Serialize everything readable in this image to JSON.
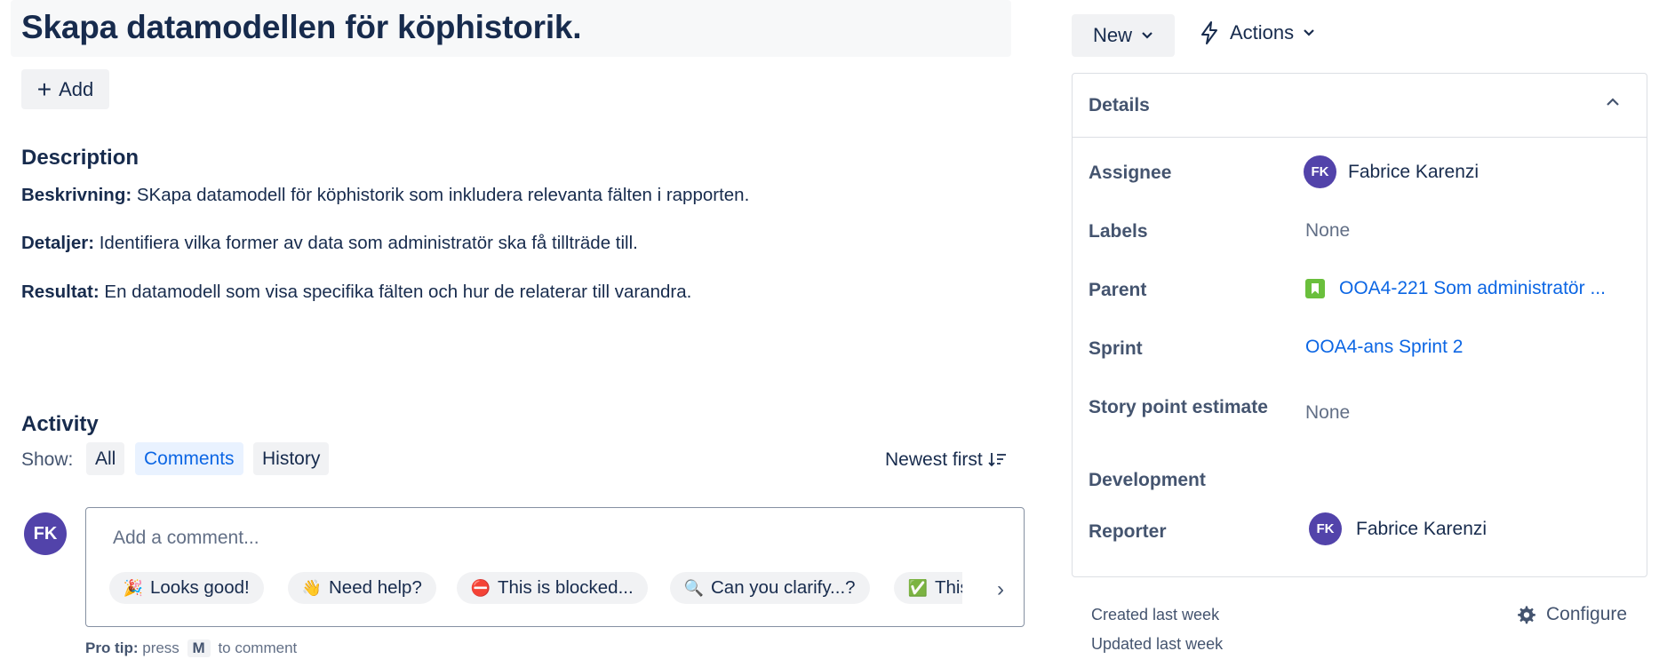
{
  "issue": {
    "title": "Skapa datamodellen för köphistorik.",
    "add_label": "Add"
  },
  "description": {
    "heading": "Description",
    "paragraphs": [
      {
        "label": "Beskrivning:",
        "text": " SKapa datamodell för köphistorik som inkludera relevanta fälten i rapporten."
      },
      {
        "label": "Detaljer:",
        "text": " Identifiera vilka former av data som administratör ska få tillträde till."
      },
      {
        "label": "Resultat:",
        "text": " En datamodell som visa specifika fälten och hur de relaterar till varandra."
      }
    ]
  },
  "activity": {
    "heading": "Activity",
    "show_label": "Show:",
    "filters": [
      "All",
      "Comments",
      "History"
    ],
    "active_filter": "Comments",
    "sort_label": "Newest first",
    "user_initials": "FK",
    "comment_placeholder": "Add a comment...",
    "quick_replies": [
      {
        "emoji": "🎉",
        "label": "Looks good!"
      },
      {
        "emoji": "👋",
        "label": "Need help?"
      },
      {
        "emoji": "⛔",
        "label": "This is blocked..."
      },
      {
        "emoji": "🔍",
        "label": "Can you clarify...?"
      },
      {
        "emoji": "✅",
        "label": "This is on track"
      }
    ],
    "protip_bold": "Pro tip:",
    "protip_press": "press",
    "protip_key": "M",
    "protip_rest": "to comment"
  },
  "status": {
    "status_label": "New",
    "actions_label": "Actions"
  },
  "details": {
    "heading": "Details",
    "assignee_label": "Assignee",
    "assignee_initials": "FK",
    "assignee_name": "Fabrice Karenzi",
    "labels_label": "Labels",
    "labels_value": "None",
    "parent_label": "Parent",
    "parent_value": "OOA4-221 Som administratör ...",
    "sprint_label": "Sprint",
    "sprint_value": "OOA4-ans Sprint 2",
    "story_points_label": "Story point estimate",
    "story_points_value": "None",
    "development_label": "Development",
    "reporter_label": "Reporter",
    "reporter_initials": "FK",
    "reporter_name": "Fabrice Karenzi"
  },
  "footer": {
    "created": "Created last week",
    "updated": "Updated last week",
    "configure_label": "Configure"
  },
  "colors": {
    "link": "#0c66e4",
    "avatar": "#5243aa",
    "active_filter_bg": "#e9f2ff",
    "parent_icon": "#6abf3c"
  }
}
